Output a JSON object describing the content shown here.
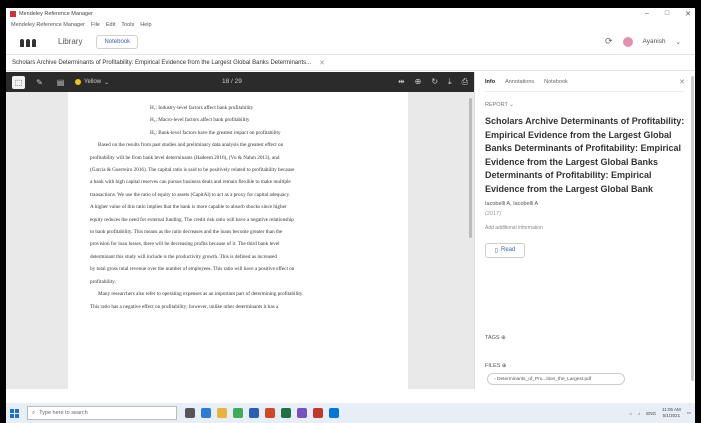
{
  "window": {
    "title": "Mendeley Reference Manager",
    "menu": [
      "Mendeley Reference Manager",
      "File",
      "Edit",
      "Tools",
      "Help"
    ],
    "controls": [
      "–",
      "□",
      "✕"
    ]
  },
  "header": {
    "library_label": "Library",
    "notebook_label": "Notebook",
    "user_name": "Ayanish"
  },
  "doc_tab": {
    "title": "Scholars Archive Determinants of Profitability: Empirical Evidence from the Largest Global Banks Determinants..."
  },
  "viewer": {
    "highlight_color": "Yellow",
    "page_indicator": "18 / 29",
    "lines": [
      {
        "cls": "ind",
        "text": "H₁: Industry-level factors affect bank profitability"
      },
      {
        "cls": "ind",
        "text": "H₂: Macro-level factors affect bank profitability"
      },
      {
        "cls": "ind",
        "text": "H₃: Bank-level factors have the greatest impact on profitability"
      },
      {
        "cls": "para",
        "text": "Based on the results from past studies and preliminary data analysis the greatest effect on"
      },
      {
        "cls": "",
        "text": "profitability will be from bank level determinants (Hadeem 2016), (Vu & Nahm 2013), and"
      },
      {
        "cls": "",
        "text": "(Garcia & Guerreiro 2016). The capital ratio is said to be positively related to profitability because"
      },
      {
        "cls": "",
        "text": "a bank with high capital reserves can pursue business deals and remain flexible to make multiple"
      },
      {
        "cls": "",
        "text": "transactions. We use the ratio of equity to assets (CapitAl) to act as a proxy for capital adequacy."
      },
      {
        "cls": "",
        "text": "A higher value of this ratio implies that the bank is more capable to absorb shocks since higher"
      },
      {
        "cls": "",
        "text": "equity reduces the need for external funding. The credit risk ratio will have a negative relationship"
      },
      {
        "cls": "",
        "text": "to bank profitability. This means as the ratio decreases and the loans become greater than the"
      },
      {
        "cls": "",
        "text": "provision for loan losses, there will be decreasing profits because of it. The third bank level"
      },
      {
        "cls": "",
        "text": "determinant this study will include is the productivity growth. This is defined as increased"
      },
      {
        "cls": "",
        "text": "by total gross total revenue over the number of employees. This ratio will have a positive effect on"
      },
      {
        "cls": "",
        "text": "profitability."
      },
      {
        "cls": "para",
        "text": "Many researchers also refer to operating expenses as an important part of determining profitability."
      },
      {
        "cls": "",
        "text": "This ratio has a negative effect on profitability; however, unlike other determinants it has a"
      }
    ]
  },
  "info": {
    "tabs": [
      "Info",
      "Annotations",
      "Notebook"
    ],
    "doc_type": "REPORT",
    "title": "Scholars Archive Determinants of Profitability: Empirical Evidence from the Largest Global Banks Determinants of Profitability: Empirical Evidence from the Largest Global Banks Determinants of Profitability: Empirical Evidence from the Largest Global Bank",
    "authors": "Iacobelli A, Iacobelli A",
    "year": "(2017)",
    "add_info": "Add additional information",
    "read_label": "Read",
    "tags_label": "TAGS",
    "files_label": "FILES",
    "file_name": "Determinants_of_Pro...ition_the_Largest.pdf"
  },
  "taskbar": {
    "search_placeholder": "Type here to search",
    "lang": "ENG",
    "time": "11:05 AM",
    "date": "5/1/2021"
  }
}
